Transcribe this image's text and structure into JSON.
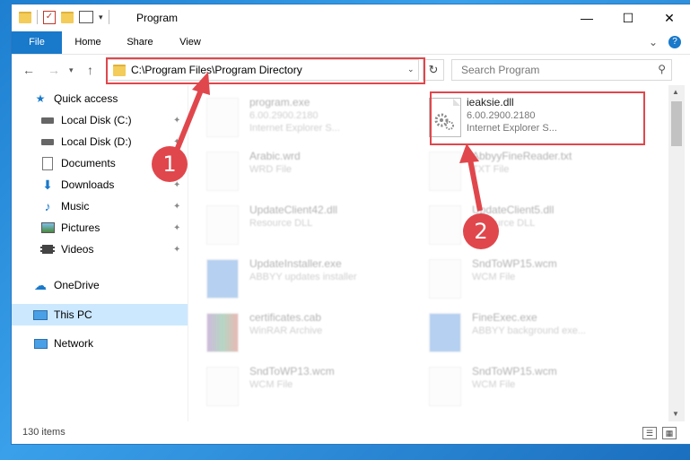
{
  "window": {
    "title": "Program",
    "controls": {
      "minimize": "—",
      "maximize": "☐",
      "close": "✕"
    }
  },
  "ribbon": {
    "tabs": [
      "File",
      "Home",
      "Share",
      "View"
    ],
    "expand_icon": "⌄",
    "help_icon": "?"
  },
  "address": {
    "path": "C:\\Program Files\\Program Directory",
    "search_placeholder": "Search Program"
  },
  "sidebar": {
    "items": [
      {
        "label": "Quick access",
        "icon": "star-icon",
        "pinned": false
      },
      {
        "label": "Local Disk (C:)",
        "icon": "drive-icon",
        "pinned": true
      },
      {
        "label": "Local Disk (D:)",
        "icon": "drive-icon",
        "pinned": true
      },
      {
        "label": "Documents",
        "icon": "documents-icon",
        "pinned": true
      },
      {
        "label": "Downloads",
        "icon": "downloads-icon",
        "pinned": true
      },
      {
        "label": "Music",
        "icon": "music-icon",
        "pinned": true
      },
      {
        "label": "Pictures",
        "icon": "pictures-icon",
        "pinned": true
      },
      {
        "label": "Videos",
        "icon": "videos-icon",
        "pinned": true
      },
      {
        "label": "OneDrive",
        "icon": "onedrive-icon",
        "pinned": false
      },
      {
        "label": "This PC",
        "icon": "this-pc-icon",
        "pinned": false,
        "selected": true
      },
      {
        "label": "Network",
        "icon": "network-icon",
        "pinned": false
      }
    ]
  },
  "files": [
    {
      "name": "program.exe",
      "line2": "6.00.2900.2180",
      "line3": "Internet Explorer S...",
      "highlighted": false
    },
    {
      "name": "ieaksie.dll",
      "line2": "6.00.2900.2180",
      "line3": "Internet Explorer S...",
      "highlighted": true
    },
    {
      "name": "Arabic.wrd",
      "line2": "WRD File",
      "line3": "",
      "highlighted": false
    },
    {
      "name": "AbbyyFineReader.txt",
      "line2": "TXT File",
      "line3": "",
      "highlighted": false
    },
    {
      "name": "UpdateClient42.dll",
      "line2": "Resource DLL",
      "line3": "",
      "highlighted": false
    },
    {
      "name": "UpdateClient5.dll",
      "line2": "Resource DLL",
      "line3": "",
      "highlighted": false
    },
    {
      "name": "UpdateInstaller.exe",
      "line2": "ABBYY updates installer",
      "line3": "",
      "highlighted": false
    },
    {
      "name": "SndToWP15.wcm",
      "line2": "WCM File",
      "line3": "",
      "highlighted": false
    },
    {
      "name": "certificates.cab",
      "line2": "WinRAR Archive",
      "line3": "",
      "highlighted": false
    },
    {
      "name": "FineExec.exe",
      "line2": "ABBYY background exe...",
      "line3": "",
      "highlighted": false
    },
    {
      "name": "SndToWP13.wcm",
      "line2": "WCM File",
      "line3": "",
      "highlighted": false
    },
    {
      "name": "SndToWP15.wcm",
      "line2": "WCM File",
      "line3": "",
      "highlighted": false
    }
  ],
  "status": {
    "item_count": "130 items"
  },
  "annotations": {
    "step1": "1",
    "step2": "2",
    "color": "#e0474c"
  }
}
